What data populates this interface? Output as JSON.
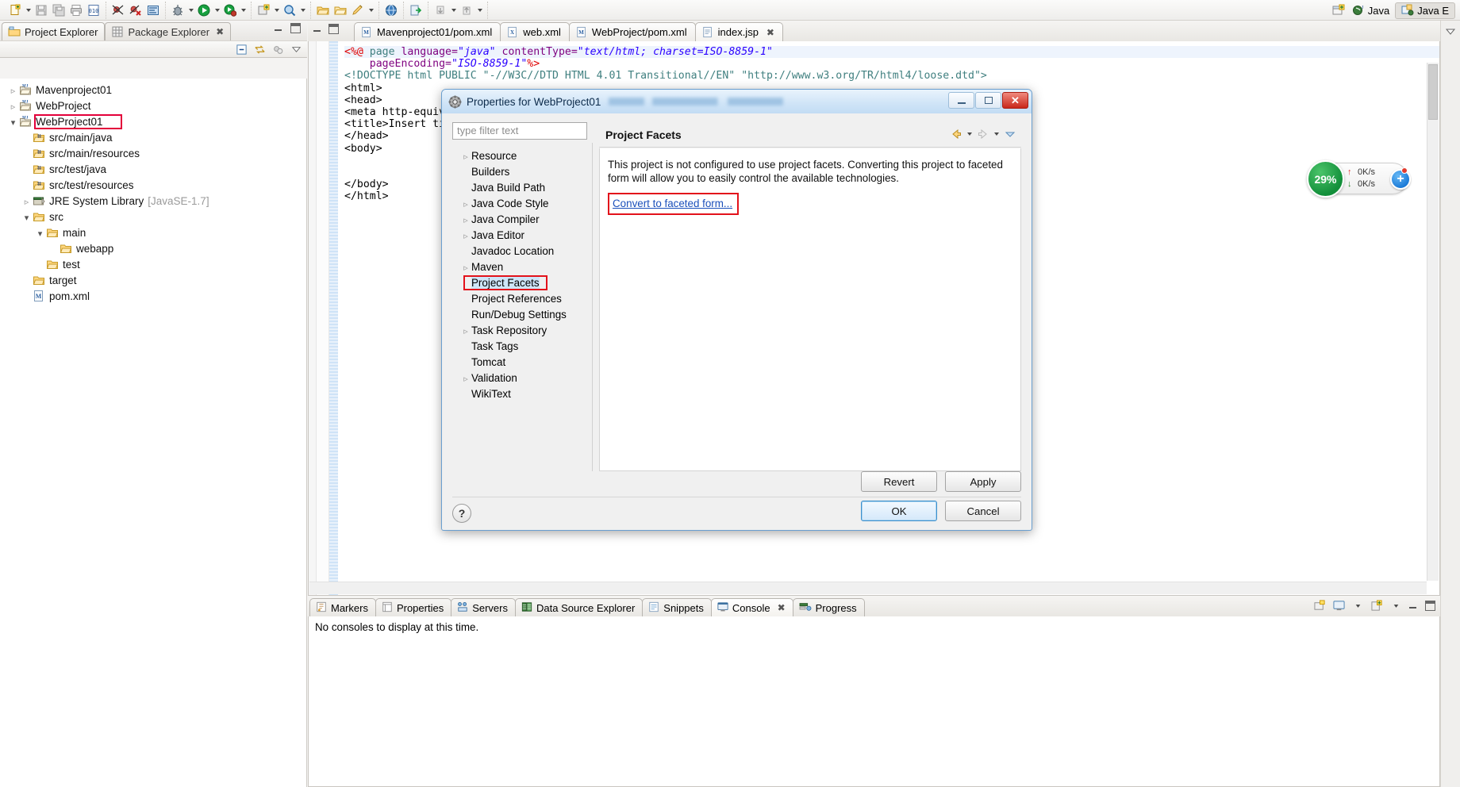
{
  "toolbar": {
    "groups": [
      {
        "items": [
          {
            "icon": "new-file-icon",
            "has_arrow": true
          },
          {
            "icon": "save-icon",
            "has_arrow": false
          },
          {
            "icon": "save-all-icon",
            "has_arrow": false
          },
          {
            "icon": "print-icon",
            "has_arrow": false
          },
          {
            "icon": "toggle-mark-occurrences-icon",
            "has_arrow": false
          }
        ]
      },
      {
        "items": [
          {
            "icon": "skip-breakpoints-icon",
            "has_arrow": false
          },
          {
            "icon": "remove-breakpoint-icon",
            "has_arrow": false
          },
          {
            "icon": "debug-view-icon",
            "has_arrow": false
          }
        ]
      },
      {
        "items": [
          {
            "icon": "debug-icon",
            "has_arrow": true
          },
          {
            "icon": "run-icon",
            "has_arrow": true
          },
          {
            "icon": "run-external-tools-icon",
            "has_arrow": true
          }
        ]
      },
      {
        "items": [
          {
            "icon": "new-java-package-icon",
            "has_arrow": true
          },
          {
            "icon": "search-icon",
            "has_arrow": true
          }
        ]
      },
      {
        "items": [
          {
            "icon": "open-folder-icon",
            "has_arrow": false
          },
          {
            "icon": "open-project-icon",
            "has_arrow": false
          },
          {
            "icon": "pencil-icon",
            "has_arrow": true
          }
        ]
      },
      {
        "items": [
          {
            "icon": "globe-icon",
            "has_arrow": false
          }
        ]
      },
      {
        "items": [
          {
            "icon": "export-icon",
            "has_arrow": false
          }
        ]
      },
      {
        "items": [
          {
            "icon": "next-annotation-icon",
            "has_arrow": true
          },
          {
            "icon": "previous-annotation-icon",
            "has_arrow": true
          }
        ]
      }
    ]
  },
  "perspective": {
    "open_perspective_label": "open-perspective-icon",
    "items": [
      {
        "label": "Java",
        "icon": "java-perspective-icon",
        "active": false
      },
      {
        "label": "Java E",
        "icon": "java-ee-perspective-icon",
        "active": true
      }
    ]
  },
  "network_widget": {
    "percent": "29%",
    "upload": "0K/s",
    "download": "0K/s",
    "plus_label": "+"
  },
  "explorer": {
    "tabs": [
      {
        "label": "Project Explorer",
        "icon": "project-explorer-icon",
        "active": true,
        "closable": false
      },
      {
        "label": "Package Explorer",
        "icon": "package-explorer-icon",
        "active": false,
        "closable": true
      }
    ],
    "view_toolbar": [
      {
        "icon": "collapse-all-icon"
      },
      {
        "icon": "link-with-editor-icon"
      },
      {
        "icon": "focus-on-active-task-icon"
      },
      {
        "icon": "view-menu-icon"
      }
    ],
    "tree": [
      {
        "label": "Mavenproject01",
        "indent": 0,
        "arrow": "collapsed",
        "icon": "maven-project-icon",
        "selected": false
      },
      {
        "label": "WebProject",
        "indent": 0,
        "arrow": "collapsed",
        "icon": "maven-project-icon",
        "selected": false
      },
      {
        "label": "WebProject01",
        "indent": 0,
        "arrow": "expanded",
        "icon": "maven-project-icon",
        "selected": true
      },
      {
        "label": "src/main/java",
        "indent": 1,
        "arrow": "none",
        "icon": "source-folder-icon",
        "selected": false
      },
      {
        "label": "src/main/resources",
        "indent": 1,
        "arrow": "none",
        "icon": "source-folder-icon",
        "selected": false
      },
      {
        "label": "src/test/java",
        "indent": 1,
        "arrow": "none",
        "icon": "source-folder-icon",
        "selected": false
      },
      {
        "label": "src/test/resources",
        "indent": 1,
        "arrow": "none",
        "icon": "source-folder-icon",
        "selected": false
      },
      {
        "label": "JRE System Library",
        "sublabel": "[JavaSE-1.7]",
        "indent": 1,
        "arrow": "collapsed",
        "icon": "jre-library-icon",
        "selected": false
      },
      {
        "label": "src",
        "indent": 1,
        "arrow": "expanded",
        "icon": "folder-icon",
        "selected": false
      },
      {
        "label": "main",
        "indent": 2,
        "arrow": "expanded",
        "icon": "folder-icon",
        "selected": false
      },
      {
        "label": "webapp",
        "indent": 3,
        "arrow": "none",
        "icon": "folder-icon",
        "selected": false
      },
      {
        "label": "test",
        "indent": 2,
        "arrow": "none",
        "icon": "folder-icon",
        "selected": false
      },
      {
        "label": "target",
        "indent": 1,
        "arrow": "none",
        "icon": "folder-icon",
        "selected": false
      },
      {
        "label": "pom.xml",
        "indent": 1,
        "arrow": "none",
        "icon": "xml-file-icon",
        "selected": false
      }
    ]
  },
  "editor": {
    "tabs": [
      {
        "label": "Mavenproject01/pom.xml",
        "icon": "maven-file-icon",
        "active": false,
        "closable": false
      },
      {
        "label": "web.xml",
        "icon": "xml-file-icon",
        "active": false,
        "closable": false
      },
      {
        "label": "WebProject/pom.xml",
        "icon": "maven-file-icon",
        "active": false,
        "closable": false
      },
      {
        "label": "index.jsp",
        "icon": "jsp-file-icon",
        "active": true,
        "closable": true
      }
    ],
    "code_lines": [
      [
        {
          "t": "<%@ ",
          "c": "k-red"
        },
        {
          "t": "page ",
          "c": "k-tag"
        },
        {
          "t": "language=",
          "c": "k-attr"
        },
        {
          "t": "\"java\"",
          "c": "k-str"
        },
        {
          "t": " contentType=",
          "c": "k-attr"
        },
        {
          "t": "\"text/html; charset=ISO-8859-1\"",
          "c": "k-str"
        }
      ],
      [
        {
          "t": "    pageEncoding=",
          "c": "k-attr"
        },
        {
          "t": "\"ISO-8859-1\"",
          "c": "k-str"
        },
        {
          "t": "%>",
          "c": "k-red"
        }
      ],
      [
        {
          "t": "<!DOCTYPE html PUBLIC \"-//W3C//DTD HTML 4.01 Transitional//EN\" \"http://www.w3.org/TR/html4/loose.dtd\">",
          "c": "k-doct"
        }
      ],
      [
        {
          "t": "<html>",
          "c": "k-txt"
        }
      ],
      [
        {
          "t": "<head>",
          "c": "k-txt"
        }
      ],
      [
        {
          "t": "<meta http-equiv=\"Content-Type\" content=\"text/html; charset=ISO-8859-1\">",
          "c": "k-txt"
        }
      ],
      [
        {
          "t": "<title>Insert title here</title>",
          "c": "k-txt"
        }
      ],
      [
        {
          "t": "</head>",
          "c": "k-txt"
        }
      ],
      [
        {
          "t": "<body>",
          "c": "k-txt"
        }
      ],
      [
        {
          "t": "",
          "c": "k-txt"
        }
      ],
      [
        {
          "t": "",
          "c": "k-txt"
        }
      ],
      [
        {
          "t": "</body>",
          "c": "k-txt"
        }
      ],
      [
        {
          "t": "</html>",
          "c": "k-txt"
        }
      ]
    ]
  },
  "bottom": {
    "tabs": [
      {
        "label": "Markers",
        "icon": "markers-icon",
        "active": false,
        "closable": false
      },
      {
        "label": "Properties",
        "icon": "properties-icon",
        "active": false,
        "closable": false
      },
      {
        "label": "Servers",
        "icon": "servers-icon",
        "active": false,
        "closable": false
      },
      {
        "label": "Data Source Explorer",
        "icon": "data-source-explorer-icon",
        "active": false,
        "closable": false
      },
      {
        "label": "Snippets",
        "icon": "snippets-icon",
        "active": false,
        "closable": false
      },
      {
        "label": "Console",
        "icon": "console-icon",
        "active": true,
        "closable": true
      },
      {
        "label": "Progress",
        "icon": "progress-icon",
        "active": false,
        "closable": false
      }
    ],
    "console_message": "No consoles to display at this time.",
    "view_toolbar": [
      {
        "icon": "open-console-icon"
      },
      {
        "icon": "display-selected-console-icon"
      },
      {
        "icon": "new-console-view-icon"
      },
      {
        "icon": "minimize-icon"
      },
      {
        "icon": "maximize-icon"
      }
    ]
  },
  "dialog": {
    "title": "Properties for WebProject01",
    "title_icon": "properties-dialog-icon",
    "window_buttons": [
      {
        "name": "minimize",
        "label": ""
      },
      {
        "name": "maximize",
        "label": ""
      },
      {
        "name": "close",
        "label": "✕"
      }
    ],
    "filter": {
      "placeholder": "type filter text",
      "value": ""
    },
    "tree": [
      {
        "label": "Resource",
        "arrow": true,
        "selected": false
      },
      {
        "label": "Builders",
        "arrow": false,
        "selected": false
      },
      {
        "label": "Java Build Path",
        "arrow": false,
        "selected": false
      },
      {
        "label": "Java Code Style",
        "arrow": true,
        "selected": false
      },
      {
        "label": "Java Compiler",
        "arrow": true,
        "selected": false
      },
      {
        "label": "Java Editor",
        "arrow": true,
        "selected": false
      },
      {
        "label": "Javadoc Location",
        "arrow": false,
        "selected": false
      },
      {
        "label": "Maven",
        "arrow": true,
        "selected": false
      },
      {
        "label": "Project Facets",
        "arrow": false,
        "selected": true
      },
      {
        "label": "Project References",
        "arrow": false,
        "selected": false
      },
      {
        "label": "Run/Debug Settings",
        "arrow": false,
        "selected": false
      },
      {
        "label": "Task Repository",
        "arrow": true,
        "selected": false
      },
      {
        "label": "Task Tags",
        "arrow": false,
        "selected": false
      },
      {
        "label": "Tomcat",
        "arrow": false,
        "selected": false
      },
      {
        "label": "Validation",
        "arrow": true,
        "selected": false
      },
      {
        "label": "WikiText",
        "arrow": false,
        "selected": false
      }
    ],
    "page": {
      "title": "Project Facets",
      "description": "This project is not configured to use project facets. Converting this project to faceted form will allow you to easily control the available technologies.",
      "link_label": "Convert to faceted form...",
      "nav_icons": [
        {
          "icon": "back-arrow-icon"
        },
        {
          "icon": "back-dropdown-icon"
        },
        {
          "icon": "forward-arrow-icon"
        },
        {
          "icon": "forward-dropdown-icon"
        },
        {
          "icon": "view-menu-icon"
        }
      ]
    },
    "buttons": {
      "help": "?",
      "revert": "Revert",
      "apply": "Apply",
      "ok": "OK",
      "cancel": "Cancel"
    }
  },
  "colors": {
    "highlight_red": "#e3121b",
    "selection_blue": "#cde5f8",
    "link_blue": "#1a4fbb",
    "title_blue": "#c2dcf4",
    "green_circle": "#128f3a"
  }
}
